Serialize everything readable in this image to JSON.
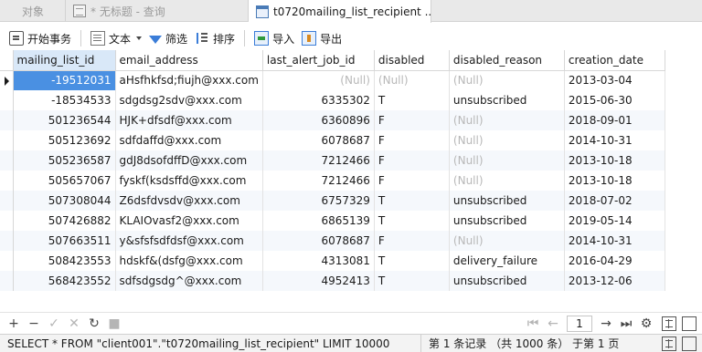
{
  "tabs": [
    {
      "label": "对象"
    },
    {
      "label": "* 无标题 - 查询"
    },
    {
      "label": "t0720mailing_list_recipient ..."
    }
  ],
  "toolbar": {
    "begin_tx": "开始事务",
    "text": "文本",
    "filter": "筛选",
    "sort": "排序",
    "import": "导入",
    "export": "导出"
  },
  "grid": {
    "columns": [
      "mailing_list_id",
      "email_address",
      "last_alert_job_id",
      "disabled",
      "disabled_reason",
      "creation_date"
    ],
    "rows": [
      [
        "-19512031",
        "aHsfhkfsd;fiujh@xxx.com",
        "(Null)",
        "(Null)",
        "(Null)",
        "2013-03-04"
      ],
      [
        "-18534533",
        "sdgdsg2sdv@xxx.com",
        "6335302",
        "T",
        "unsubscribed",
        "2015-06-30"
      ],
      [
        "501236544",
        "HJK+dfsdf@xxx.com",
        "6360896",
        "F",
        "(Null)",
        "2018-09-01"
      ],
      [
        "505123692",
        "sdfdaffd@xxx.com",
        "6078687",
        "F",
        "(Null)",
        "2014-10-31"
      ],
      [
        "505236587",
        "gdJ8dsofdffD@xxx.com",
        "7212466",
        "F",
        "(Null)",
        "2013-10-18"
      ],
      [
        "505657067",
        "fyskf(ksdsffd@xxx.com",
        "7212466",
        "F",
        "(Null)",
        "2013-10-18"
      ],
      [
        "507308044",
        "Z6dsfdvsdv@xxx.com",
        "6757329",
        "T",
        "unsubscribed",
        "2018-07-02"
      ],
      [
        "507426882",
        "KLAIOvasf2@xxx.com",
        "6865139",
        "T",
        "unsubscribed",
        "2019-05-14"
      ],
      [
        "507663511",
        "y&sfsfsdfdsf@xxx.com",
        "6078687",
        "F",
        "(Null)",
        "2014-10-31"
      ],
      [
        "508423553",
        "hdskf&(dsfg@xxx.com",
        "4313081",
        "T",
        "delivery_failure",
        "2016-04-29"
      ],
      [
        "568423552",
        "sdfsdgsdg^@xxx.com",
        "4952413",
        "T",
        "unsubscribed",
        "2013-12-06"
      ]
    ]
  },
  "nav": {
    "page": "1"
  },
  "status": {
    "sql": "SELECT * FROM \"client001\".\"t0720mailing_list_recipient\" LIMIT 10000",
    "records": "第 1 条记录 （共 1000 条） 于第 1 页"
  }
}
